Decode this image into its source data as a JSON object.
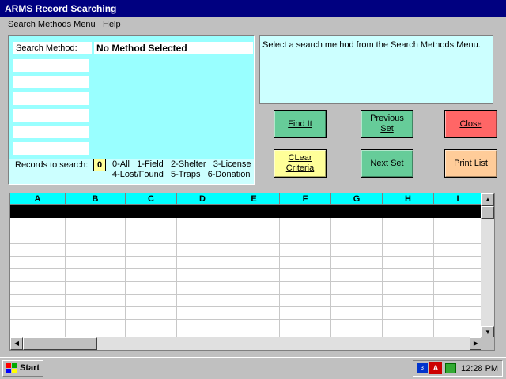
{
  "window": {
    "title": "ARMS Record Searching"
  },
  "menu": [
    {
      "label": "Search Methods Menu",
      "underline": "S"
    },
    {
      "label": "Help",
      "underline": "H"
    }
  ],
  "search": {
    "method_label": "Search Method:",
    "method_value": "No Method Selected",
    "records_label": "Records to search:",
    "records_value": "0",
    "legend_line1": "0-All   1-Field   2-Shelter   3-License",
    "legend_line2": "4-Lost/Found   5-Traps   6-Donation"
  },
  "status_message": "Select a search method from the Search Methods Menu.",
  "buttons": {
    "find_it": "Find It",
    "previous_set": "Previous Set",
    "close": "Close",
    "clear_criteria": "CLear Criteria",
    "next_set": "Next Set",
    "print_list": "Print List"
  },
  "grid": {
    "columns": [
      "A",
      "B",
      "C",
      "D",
      "E",
      "F",
      "G",
      "H",
      "I"
    ]
  },
  "taskbar": {
    "start_label": "Start",
    "clock": "12:28 PM"
  },
  "colors": {
    "title_bar": "#000080",
    "panel_cyan": "#99ffff",
    "btn_green": "#66cc99",
    "btn_red": "#ff6666",
    "btn_yellow": "#ffff99",
    "btn_orange": "#ffcc99"
  }
}
